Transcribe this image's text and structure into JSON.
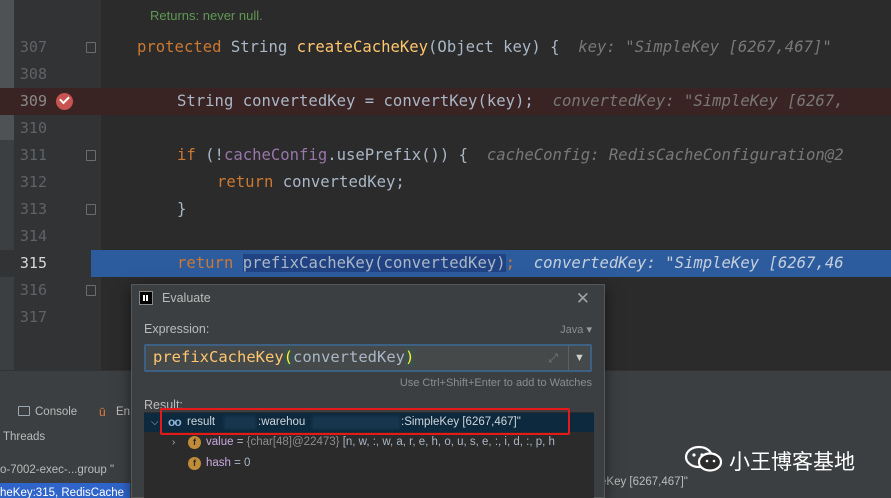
{
  "editor": {
    "returns_doc": "Returns: never null.",
    "lines": [
      {
        "num": "307",
        "key": "l307"
      },
      {
        "num": "308",
        "key": "l308"
      },
      {
        "num": "309",
        "key": "l309"
      },
      {
        "num": "310",
        "key": "l310"
      },
      {
        "num": "311",
        "key": "l311"
      },
      {
        "num": "312",
        "key": "l312"
      },
      {
        "num": "313",
        "key": "l313"
      },
      {
        "num": "314",
        "key": "l314"
      },
      {
        "num": "315",
        "key": "l315"
      },
      {
        "num": "316",
        "key": "l316"
      },
      {
        "num": "317",
        "key": "l317"
      }
    ],
    "l307": {
      "kw": "protected",
      "type": " String ",
      "fn": "createCacheKey",
      "rest": "(Object key) {",
      "hint": "key: \"SimpleKey [6267,467]\""
    },
    "l309": {
      "pre": "String convertedKey = ",
      "fn": "convertKey",
      "rest": "(key);",
      "hint": "convertedKey: \"SimpleKey [6267,"
    },
    "l311": {
      "kw": "if",
      "p1": " (!",
      "field": "cacheConfig",
      "rest": ".usePrefix()) {",
      "hint": "cacheConfig: RedisCacheConfiguration@2"
    },
    "l312": {
      "kw": "return",
      "rest": " convertedKey;"
    },
    "l313": {
      "rest": "}"
    },
    "l315": {
      "kw": "return",
      "sel": "prefixCacheKey(convertedKey)",
      "semi": ";",
      "hint": "convertedKey: \"SimpleKey [6267,46"
    }
  },
  "debug_panel": {
    "console_tab": "Console",
    "endpoints_tab": "En",
    "threads_label": "Threads",
    "thread_row": "o-7002-exec-...group \"",
    "frame_row": "heKey:315, RedisCache",
    "bottom_value": "eKey [6267,467]\""
  },
  "evaluate_dialog": {
    "title": "Evaluate",
    "close": "✕",
    "expression_label": "Expression:",
    "language": "Java",
    "expression_fn": "prefixCacheKey",
    "expression_arg": "convertedKey",
    "expand_icon": "⤢",
    "dropdown": "▼",
    "watch_hint": "Use Ctrl+Shift+Enter to add to Watches",
    "result_label": "Result:",
    "result": {
      "name": "result",
      "mid": ":warehou",
      "value": ":SimpleKey [6267,467]\"",
      "children": [
        {
          "name": "value",
          "eq": " = ",
          "type": "{char[48]@22473}",
          "val": " [n, w, :, w, a, r, e, h, o, u, s, e, :, i, d, :, p, h"
        },
        {
          "name": "hash",
          "eq": " = ",
          "val": "0"
        }
      ]
    }
  },
  "watermark": {
    "text": "小王博客基地"
  },
  "colors": {
    "keyword": "#cc7832",
    "function": "#ffc66d",
    "field": "#9876aa",
    "current_line": "#2d5c9e",
    "highlight_box": "#e3191c"
  }
}
